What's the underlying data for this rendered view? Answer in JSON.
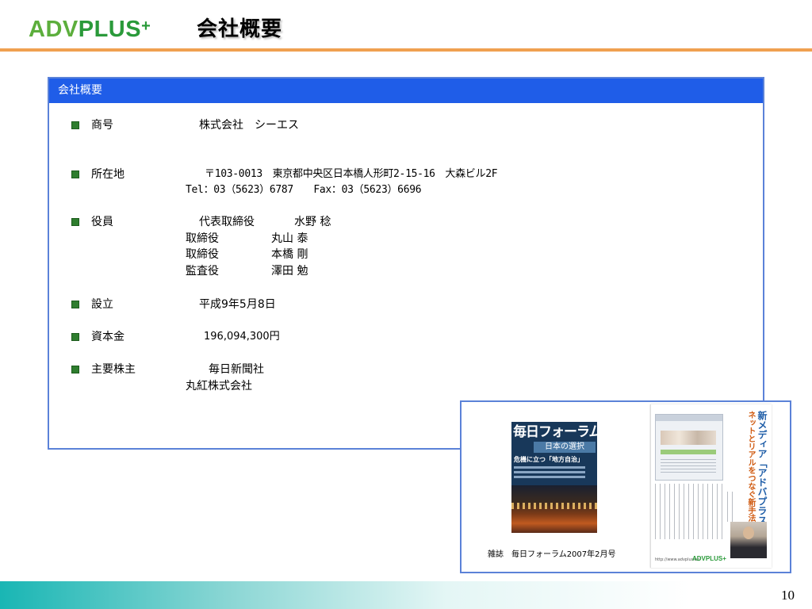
{
  "header": {
    "logo": {
      "adv": "ADV",
      "plus_word": "PLUS",
      "plus_sign": "+"
    },
    "title": "会社概要",
    "accent_color": "#f0a050"
  },
  "panel": {
    "header": "会社概要",
    "header_color": "#1f5de8",
    "items": [
      {
        "label": "商号",
        "lines": [
          "株式会社　シーエス"
        ]
      },
      {
        "label": "所在地",
        "lines": [
          "〒103-0013　東京都中央区日本橋人形町2-15-16　大森ビル2F",
          "Tel：03（5623）6787　　Fax：03（5623）6696"
        ]
      },
      {
        "label": "役員",
        "lines": [
          {
            "role": "代表取締役",
            "name": "水野 稔"
          },
          {
            "role": "取締役",
            "name": "丸山 泰"
          },
          {
            "role": "取締役",
            "name": "本橋 剛"
          },
          {
            "role": "監査役",
            "name": "澤田 勉"
          }
        ]
      },
      {
        "label": "設立",
        "lines": [
          "平成9年5月8日"
        ]
      },
      {
        "label": "資本金",
        "lines": [
          "196,094,300円"
        ]
      },
      {
        "label": "主要株主",
        "lines": [
          "毎日新聞社",
          "丸紅株式会社"
        ]
      }
    ]
  },
  "inset": {
    "caption": "雑誌　毎日フォーラム2007年2月号",
    "cover": {
      "title": "毎日フォーラム",
      "band": "日本の選択",
      "headline": "危機に立つ「地方自治」"
    },
    "article": {
      "vertical_title_1": "ネットとリアルをつなぐ新手法",
      "vertical_title_2": "新メディア「アドバプラス」",
      "footer_url": "http://www.advplus.tv/",
      "logo": "ADVPLUS+"
    }
  },
  "footer": {
    "page_number": "10"
  }
}
